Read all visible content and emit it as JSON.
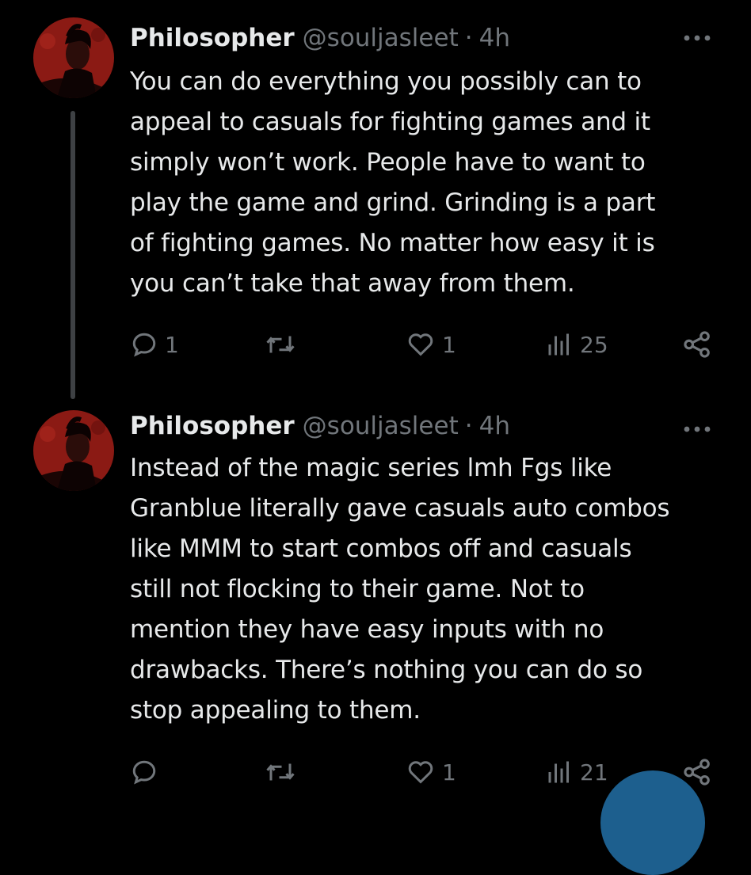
{
  "tweets": [
    {
      "author": {
        "display_name": "Philosopher",
        "handle": "@souljasleet",
        "separator": "·",
        "time": "4h"
      },
      "text": "You can do everything you possibly can to\nappeal to casuals for fighting games and it\nsimply won’t work. People have to want to\nplay the game and grind. Grinding is a part\nof fighting games. No matter how easy it is\nyou can’t take that away from them.",
      "stats": {
        "replies": "1",
        "retweets": "",
        "likes": "1",
        "views": "25"
      }
    },
    {
      "author": {
        "display_name": "Philosopher",
        "handle": "@souljasleet",
        "separator": "·",
        "time": "4h"
      },
      "text": "Instead of the magic series lmh Fgs like\nGranblue literally gave casuals auto combos\nlike MMM to start combos off and casuals\nstill not flocking to their game. Not to\nmention they have easy inputs with no\ndrawbacks. There’s nothing you can do so\nstop appealing to them.",
      "stats": {
        "replies": "",
        "retweets": "",
        "likes": "1",
        "views": "21"
      }
    }
  ],
  "icons": {
    "more": "more-options-icon",
    "reply": "reply-icon",
    "retweet": "retweet-icon",
    "like": "heart-icon",
    "views": "views-icon",
    "share": "share-icon",
    "compose": "compose-fab"
  },
  "colors": {
    "background": "#000000",
    "text_primary": "#e7e9ea",
    "text_secondary": "#71767b",
    "thread_line": "#3e4144",
    "avatar_accent": "#8b1a14",
    "fab": "#1d5f8e"
  }
}
